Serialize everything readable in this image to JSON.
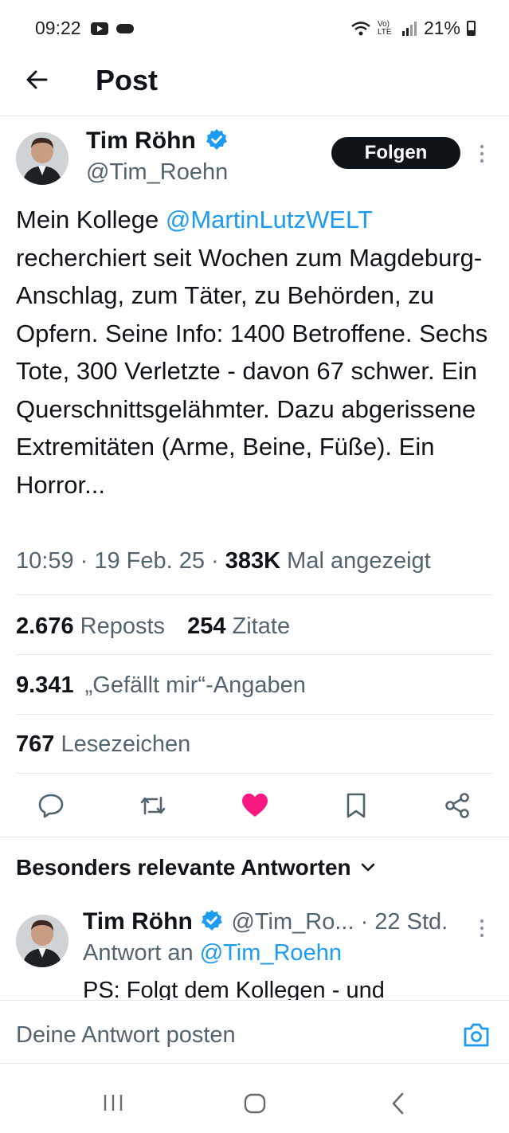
{
  "status_bar": {
    "time": "09:22",
    "battery": "21%",
    "network": "Vo) LTE"
  },
  "header": {
    "title": "Post"
  },
  "post": {
    "author_name": "Tim Röhn",
    "author_handle": "@Tim_Roehn",
    "follow_label": "Folgen",
    "text_before": "Mein Kollege ",
    "mention": "@MartinLutzWELT",
    "text_after": " recherchiert seit Wochen zum Magdeburg-Anschlag, zum Täter, zu Behörden, zu Opfern. Seine Info: 1400 Betroffene. Sechs Tote, 300 Verletzte - davon 67 schwer. Ein Querschnittsgelähmter. Dazu abgerissene Extremitäten (Arme, Beine, Füße). Ein Horror...",
    "meta_time": "10:59 · 19 Feb. 25 · ",
    "views": "383K",
    "views_label": " Mal angezeigt"
  },
  "stats": {
    "reposts_count": "2.676",
    "reposts_label": " Reposts",
    "quotes_count": "254",
    "quotes_label": " Zitate",
    "likes_count": "9.341",
    "likes_label": " „Gefällt mir“-Angaben",
    "bookmarks_count": "767",
    "bookmarks_label": " Lesezeichen"
  },
  "replies": {
    "section_title": "Besonders relevante Antworten",
    "items": [
      {
        "author_name": "Tim Röhn",
        "author_handle": "@Tim_Ro...",
        "time": " · 22 Std.",
        "reply_to_prefix": "Antwort an ",
        "reply_to_handle": "@Tim_Roehn",
        "text": "PS: Folgt dem Kollegen - und"
      }
    ]
  },
  "composer": {
    "placeholder": "Deine Antwort posten"
  },
  "colors": {
    "accent": "#1d9bf0",
    "like": "#f91880",
    "text": "#0f1419",
    "secondary": "#536471"
  },
  "icons": {
    "action_bar": [
      "reply-icon",
      "repost-icon",
      "like-icon",
      "bookmark-icon",
      "share-icon"
    ]
  }
}
